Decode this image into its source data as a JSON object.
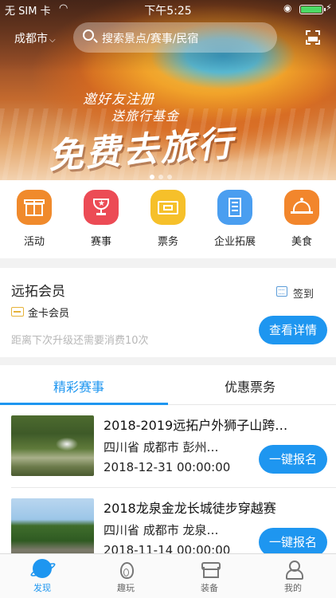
{
  "status_bar": {
    "carrier": "无 SIM 卡",
    "time": "下午5:25"
  },
  "header": {
    "city": "成都市",
    "search_placeholder": "搜索景点/赛事/民宿"
  },
  "banner": {
    "line1": "邀好友注册",
    "line2": "送旅行基金",
    "headline": "免费去旅行"
  },
  "categories": [
    {
      "label": "活动",
      "icon": "gift-icon",
      "color": "#f08a2c"
    },
    {
      "label": "赛事",
      "icon": "trophy-icon",
      "color": "#ec4b55"
    },
    {
      "label": "票务",
      "icon": "ticket-icon",
      "color": "#f6c02a"
    },
    {
      "label": "企业拓展",
      "icon": "building-icon",
      "color": "#4a9ef0"
    },
    {
      "label": "美食",
      "icon": "food-dome-icon",
      "color": "#f2862c"
    }
  ],
  "member": {
    "title": "远拓会员",
    "sign_label": "签到",
    "level": "金卡会员",
    "hint": "距离下次升级还需要消费10次",
    "detail_button": "查看详情"
  },
  "tabs": [
    {
      "label": "精彩赛事",
      "active": true
    },
    {
      "label": "优惠票务",
      "active": false
    }
  ],
  "events": [
    {
      "name": "2018-2019远拓户外狮子山跨…",
      "location": "四川省 成都市 彭州…",
      "date": "2018-12-31 00:00:00",
      "button": "一键报名"
    },
    {
      "name": "2018龙泉金龙长城徒步穿越赛",
      "location": "四川省 成都市 龙泉…",
      "date": "2018-11-14 00:00:00",
      "button": "一键报名"
    }
  ],
  "nav": [
    {
      "label": "发现",
      "icon": "discover-planet-icon",
      "active": true
    },
    {
      "label": "趣玩",
      "icon": "fire-icon",
      "active": false
    },
    {
      "label": "装备",
      "icon": "store-icon",
      "active": false
    },
    {
      "label": "我的",
      "icon": "user-icon",
      "active": false
    }
  ],
  "colors": {
    "accent": "#1e96f0",
    "gold": "#e6b33a"
  }
}
